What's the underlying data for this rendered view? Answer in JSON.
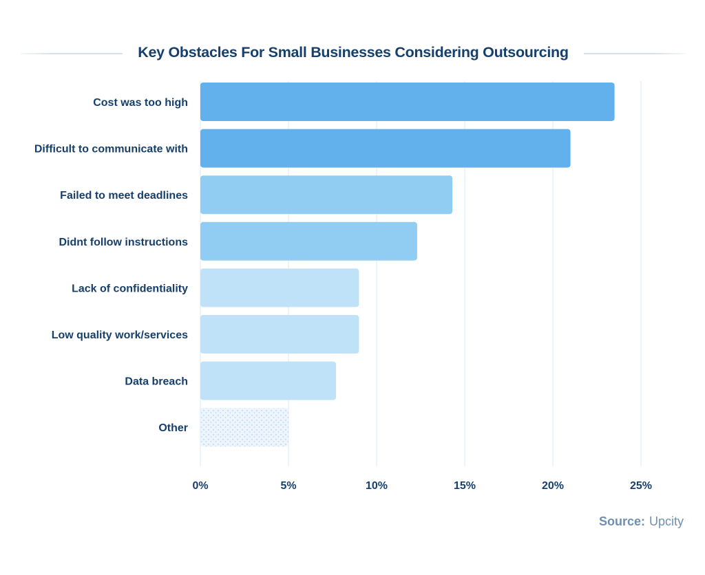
{
  "colors": {
    "title": "#173f6b",
    "label": "#173f6b",
    "source": "#6f8fb0",
    "grid": "#e6eff8",
    "bar_dark": "#62b1ec",
    "bar_mid": "#91cdf3",
    "bar_light": "#c0e2f8",
    "bar_pattern_bg": "#edf4fc",
    "bar_pattern_dot": "#a9d3f2"
  },
  "source": {
    "key": "Source:",
    "value": "Upcity"
  },
  "chart_data": {
    "type": "bar",
    "orientation": "horizontal",
    "title": "Key Obstacles For Small Businesses Considering Outsourcing",
    "xlabel": "",
    "ylabel": "",
    "categories": [
      "Cost was too high",
      "Difficult to communicate with",
      "Failed to meet deadlines",
      "Didnt follow instructions",
      "Lack of confidentiality",
      "Low quality work/services",
      "Data breach",
      "Other"
    ],
    "values": [
      23.5,
      21.0,
      14.3,
      12.3,
      9.0,
      9.0,
      7.7,
      5.0
    ],
    "value_unit": "%",
    "bar_styles": [
      "dark",
      "dark",
      "mid",
      "mid",
      "light",
      "light",
      "light",
      "pattern"
    ],
    "xlim": [
      0,
      25
    ],
    "x_ticks": [
      0,
      5,
      10,
      15,
      20,
      25
    ],
    "x_tick_labels": [
      "0%",
      "5%",
      "10%",
      "15%",
      "20%",
      "25%"
    ],
    "grid": "vertical",
    "legend": "none"
  }
}
